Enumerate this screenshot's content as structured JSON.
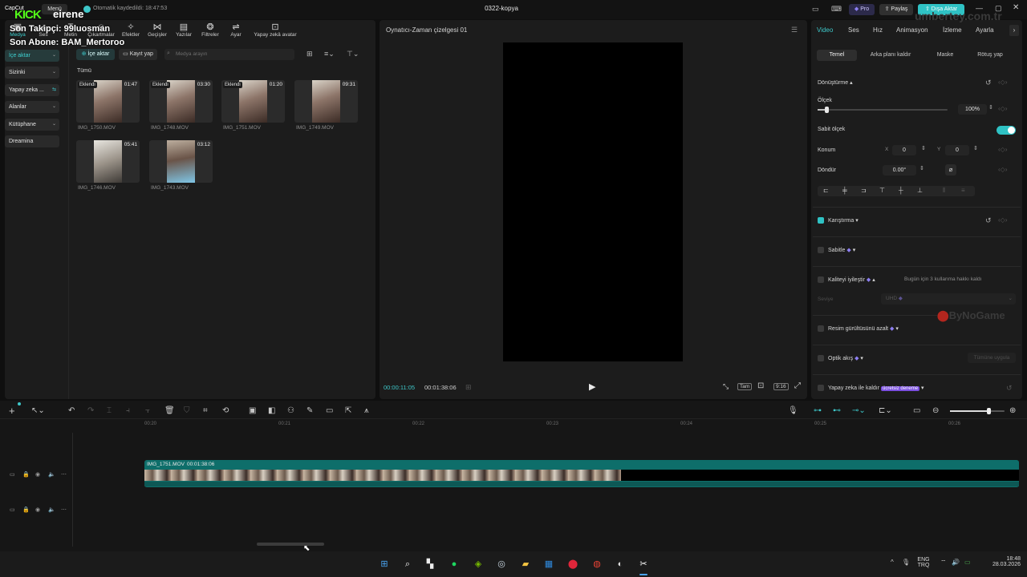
{
  "window": {
    "app_name": "CapCut",
    "menu_label": "Menü",
    "autosave": "Otomatik kaydedildi: 18:47:53",
    "project_title": "0322-kopya",
    "pro_label": "Pro",
    "share_label": "Paylaş",
    "export_label": "Dışa Aktar"
  },
  "overlay": {
    "kick_logo": "KICK",
    "kick_channel": "eirene",
    "last_follower": "Son Takipçi: 99luosman",
    "last_sub": "Son Abone: BAM_Mertoroo",
    "watermark_site": "umbertey.com.tr",
    "watermark_bynogame": "ByNoGame"
  },
  "media_toolbar": [
    {
      "label": "Medya",
      "icon": "media-icon"
    },
    {
      "label": "Ses",
      "icon": "audio-icon"
    },
    {
      "label": "Metin",
      "icon": "text-icon"
    },
    {
      "label": "Çıkartmalar",
      "icon": "sticker-icon"
    },
    {
      "label": "Efektler",
      "icon": "effects-icon"
    },
    {
      "label": "Geçişler",
      "icon": "transitions-icon"
    },
    {
      "label": "Yazılar",
      "icon": "captions-icon"
    },
    {
      "label": "Filtreler",
      "icon": "filters-icon"
    },
    {
      "label": "Ayar",
      "icon": "adjust-icon"
    },
    {
      "label": "Yapay zekâ avatar",
      "icon": "ai-avatar-icon"
    }
  ],
  "sidebar": {
    "items": [
      {
        "label": "İçe aktar"
      },
      {
        "label": "Sizinki"
      },
      {
        "label": "Yapay zeka ..."
      },
      {
        "label": "Alanlar"
      },
      {
        "label": "Kütüphane"
      },
      {
        "label": "Dreamina"
      }
    ]
  },
  "media": {
    "import_label": "İçe aktar",
    "record_label": "Kayıt yap",
    "search_placeholder": "Medya arayın",
    "section_label": "Tümü",
    "items": [
      {
        "name": "IMG_1750.MOV",
        "duration": "01:47",
        "badge": "Eklendi"
      },
      {
        "name": "IMG_1748.MOV",
        "duration": "03:30",
        "badge": "Eklendi"
      },
      {
        "name": "IMG_1751.MOV",
        "duration": "01:20",
        "badge": "Eklendi"
      },
      {
        "name": "IMG_1749.MOV",
        "duration": "09:31",
        "badge": ""
      },
      {
        "name": "IMG_1746.MOV",
        "duration": "05:41",
        "badge": ""
      },
      {
        "name": "IMG_1743.MOV",
        "duration": "03:12",
        "badge": ""
      }
    ]
  },
  "player": {
    "title": "Oynatıcı-Zaman çizelgesi 01",
    "current_time": "00:00:11:05",
    "total_time": "00:01:38:06",
    "quality_label": "Tam",
    "ratio_label": "9:16"
  },
  "properties": {
    "tabs": [
      "Video",
      "Ses",
      "Hız",
      "Animasyon",
      "İzleme",
      "Ayarla"
    ],
    "subtabs": [
      "Temel",
      "Arka planı kaldır",
      "Maske",
      "Rötuş yap"
    ],
    "transform_label": "Dönüştürme",
    "scale_label": "Ölçek",
    "scale_value": "100%",
    "scale_fraction": 0.07,
    "uniform_scale_label": "Sabit ölçek",
    "position_label": "Konum",
    "pos_x_label": "X",
    "pos_x": "0",
    "pos_y_label": "Y",
    "pos_y": "0",
    "rotate_label": "Döndür",
    "rotate_value": "0.00°",
    "blend_label": "Karıştırma",
    "stabilize_label": "Sabitle",
    "enhance_label": "Kaliteyi iyileştir",
    "enhance_note": "Bugün için 3 kullanma hakkı kaldı",
    "level_label": "Seviye",
    "level_value": "UHD",
    "denoise_label": "Resim gürültüsünü azalt",
    "optical_flow_label": "Optik akış",
    "apply_all_label": "Tümüne uygula",
    "ai_remove_label": "Yapay zeka ile kaldır",
    "free_trial_label": "ücretsiz deneme"
  },
  "timeline": {
    "ruler": [
      "00:20",
      "00:21",
      "00:22",
      "00:23",
      "00:24",
      "00:25",
      "00:26"
    ],
    "clip_name": "IMG_1751.MOV",
    "clip_duration": "00:01:38:06",
    "zoom_fraction": 0.7
  },
  "taskbar": {
    "lang": "ENG",
    "lang2": "TRQ",
    "time": "18:48",
    "date": "28.03.2026"
  },
  "colors": {
    "accent": "#3ec7c9",
    "export_btn": "#2fc2c4",
    "clip": "#0e6e6a",
    "pro": "#7b6cf0"
  }
}
